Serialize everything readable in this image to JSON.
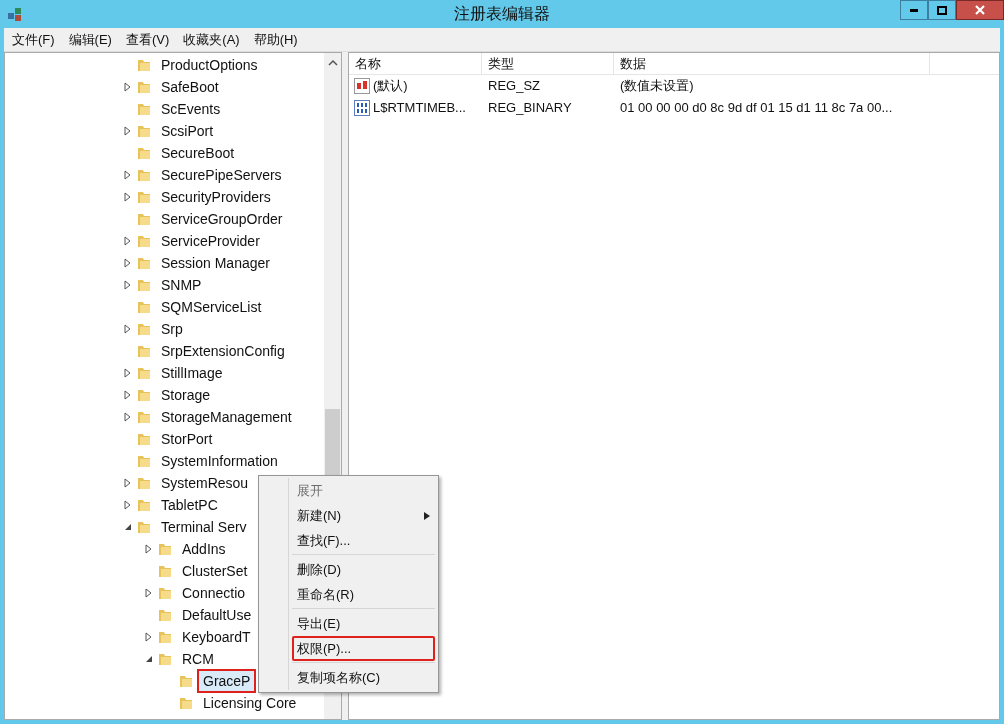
{
  "window": {
    "title": "注册表编辑器"
  },
  "menu_bar": [
    "文件(F)",
    "编辑(E)",
    "查看(V)",
    "收藏夹(A)",
    "帮助(H)"
  ],
  "tree": [
    {
      "label": "ProductOptions",
      "expandable": false,
      "selected": false
    },
    {
      "label": "SafeBoot",
      "expandable": true,
      "expanded": false,
      "selected": false
    },
    {
      "label": "ScEvents",
      "expandable": false,
      "selected": false
    },
    {
      "label": "ScsiPort",
      "expandable": true,
      "expanded": false,
      "selected": false
    },
    {
      "label": "SecureBoot",
      "expandable": false,
      "selected": false
    },
    {
      "label": "SecurePipeServers",
      "expandable": true,
      "expanded": false,
      "selected": false
    },
    {
      "label": "SecurityProviders",
      "expandable": true,
      "expanded": false,
      "selected": false
    },
    {
      "label": "ServiceGroupOrder",
      "expandable": false,
      "selected": false
    },
    {
      "label": "ServiceProvider",
      "expandable": true,
      "expanded": false,
      "selected": false
    },
    {
      "label": "Session Manager",
      "expandable": true,
      "expanded": false,
      "selected": false
    },
    {
      "label": "SNMP",
      "expandable": true,
      "expanded": false,
      "selected": false
    },
    {
      "label": "SQMServiceList",
      "expandable": false,
      "selected": false
    },
    {
      "label": "Srp",
      "expandable": true,
      "expanded": false,
      "selected": false
    },
    {
      "label": "SrpExtensionConfig",
      "expandable": false,
      "selected": false
    },
    {
      "label": "StillImage",
      "expandable": true,
      "expanded": false,
      "selected": false
    },
    {
      "label": "Storage",
      "expandable": true,
      "expanded": false,
      "selected": false
    },
    {
      "label": "StorageManagement",
      "expandable": true,
      "expanded": false,
      "selected": false
    },
    {
      "label": "StorPort",
      "expandable": false,
      "selected": false
    },
    {
      "label": "SystemInformation",
      "expandable": false,
      "selected": false
    },
    {
      "label": "SystemResou",
      "expandable": true,
      "expanded": false,
      "selected": false
    },
    {
      "label": "TabletPC",
      "expandable": true,
      "expanded": false,
      "selected": false
    },
    {
      "label": "Terminal Serv",
      "expandable": true,
      "expanded": true,
      "selected": false,
      "children": [
        {
          "label": "AddIns",
          "expandable": true,
          "expanded": false,
          "selected": false
        },
        {
          "label": "ClusterSet",
          "expandable": false,
          "selected": false
        },
        {
          "label": "Connectio",
          "expandable": true,
          "expanded": false,
          "selected": false
        },
        {
          "label": "DefaultUse",
          "expandable": false,
          "selected": false
        },
        {
          "label": "KeyboardT",
          "expandable": true,
          "expanded": false,
          "selected": false
        },
        {
          "label": "RCM",
          "expandable": true,
          "expanded": true,
          "selected": false,
          "children": [
            {
              "label": "GraceP",
              "expandable": false,
              "selected": true,
              "highlighted": true
            },
            {
              "label": "Licensing Core",
              "expandable": false,
              "selected": false
            }
          ]
        }
      ]
    }
  ],
  "values_table": {
    "columns": [
      "名称",
      "类型",
      "数据"
    ],
    "rows": [
      {
        "kind": "string",
        "name": "(默认)",
        "type": "REG_SZ",
        "data": "(数值未设置)"
      },
      {
        "kind": "binary",
        "name": "L$RTMTIMEB...",
        "type": "REG_BINARY",
        "data": "01 00 00 00 d0 8c 9d df 01 15 d1 11 8c 7a 00..."
      }
    ]
  },
  "context_menu": {
    "groups": [
      [
        {
          "label": "展开",
          "disabled": true,
          "submenu": false,
          "highlighted": false
        },
        {
          "label": "新建(N)",
          "disabled": false,
          "submenu": true,
          "highlighted": false
        },
        {
          "label": "查找(F)...",
          "disabled": false,
          "submenu": false,
          "highlighted": false
        }
      ],
      [
        {
          "label": "删除(D)",
          "disabled": false,
          "submenu": false,
          "highlighted": false
        },
        {
          "label": "重命名(R)",
          "disabled": false,
          "submenu": false,
          "highlighted": false
        }
      ],
      [
        {
          "label": "导出(E)",
          "disabled": false,
          "submenu": false,
          "highlighted": false
        },
        {
          "label": "权限(P)...",
          "disabled": false,
          "submenu": false,
          "highlighted": true
        }
      ],
      [
        {
          "label": "复制项名称(C)",
          "disabled": false,
          "submenu": false,
          "highlighted": false
        }
      ]
    ]
  }
}
